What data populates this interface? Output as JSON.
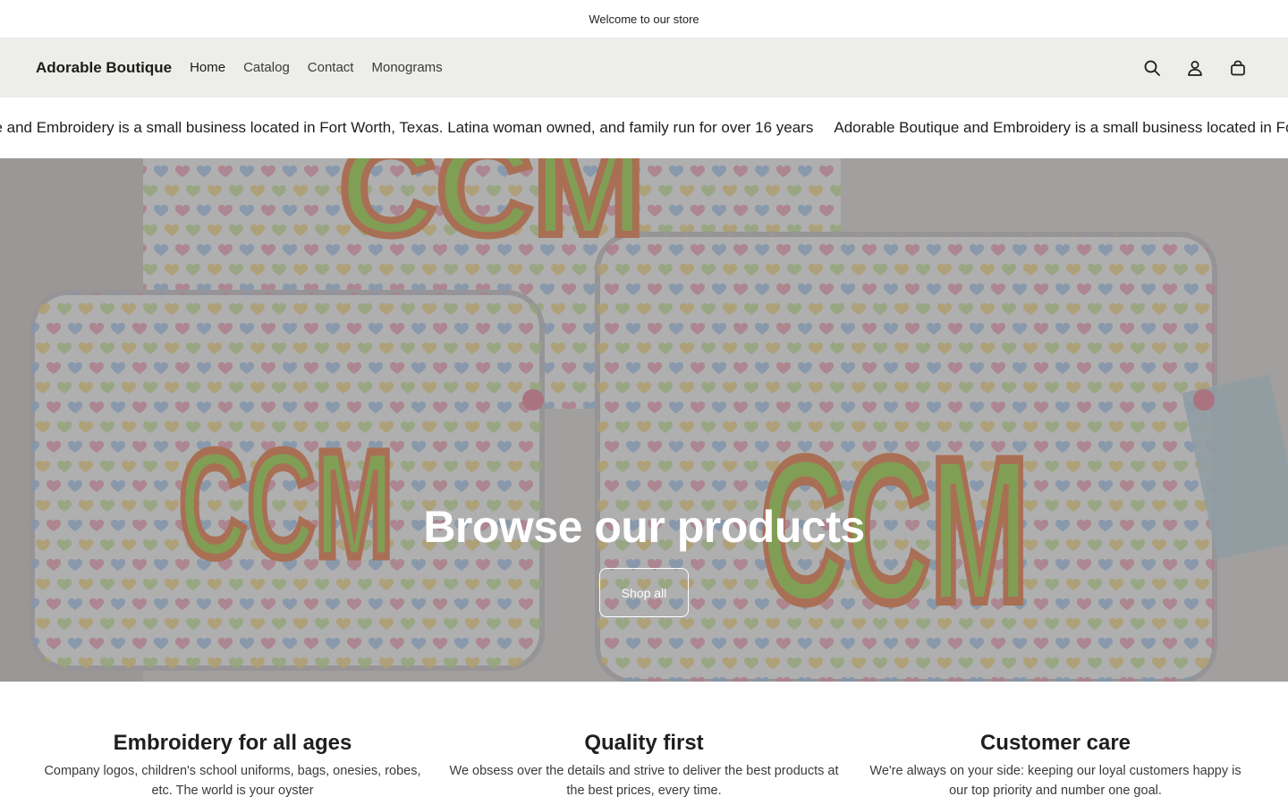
{
  "announcement": {
    "text": "Welcome to our store"
  },
  "header": {
    "logo": "Adorable Boutique",
    "nav": [
      {
        "label": "Home"
      },
      {
        "label": "Catalog"
      },
      {
        "label": "Contact"
      },
      {
        "label": "Monograms"
      }
    ],
    "icons": [
      "search-icon",
      "account-icon",
      "cart-icon"
    ]
  },
  "marquee": {
    "items": [
      "ue and Embroidery is a small business located in Fort Worth, Texas. Latina woman owned, and family run for over 16 years",
      "Adorable Boutique and Embroidery is a small business located in Fort Worth, Texas. Latina woman owned, and family run for over 16 years"
    ]
  },
  "hero": {
    "title": "Browse our products",
    "button_label": "Shop all",
    "image_text": [
      "CCM",
      "CCM",
      "CCM"
    ]
  },
  "features": [
    {
      "title": "Embroidery for all ages",
      "text": "Company logos, children's school uniforms, bags, onesies, robes, etc. The world is your oyster"
    },
    {
      "title": "Quality first",
      "text": "We obsess over the details and strive to deliver the best products at the best prices, every time."
    },
    {
      "title": "Customer care",
      "text": "We're always on your side: keeping our loyal customers happy is our top priority and number one goal."
    }
  ],
  "colors": {
    "header_bg": "#edeeea",
    "overlay": "rgba(0,0,0,0.30)",
    "monogram_orange": "#f2a07a",
    "monogram_green": "#b9e27a"
  }
}
